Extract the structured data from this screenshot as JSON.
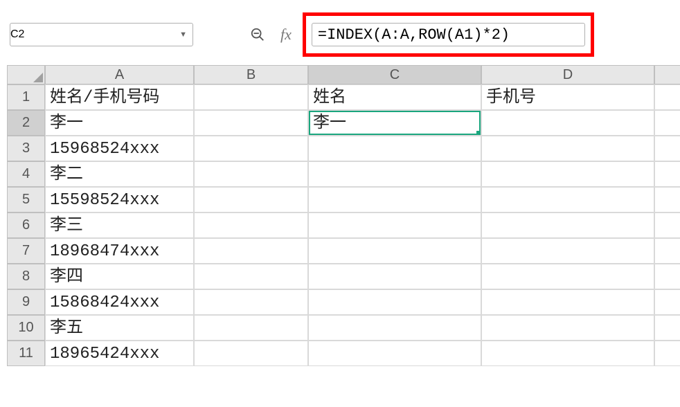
{
  "name_box": {
    "value": "C2"
  },
  "formula_bar": {
    "value": "=INDEX(A:A,ROW(A1)*2)"
  },
  "columns": [
    "A",
    "B",
    "C",
    "D"
  ],
  "row_numbers": [
    1,
    2,
    3,
    4,
    5,
    6,
    7,
    8,
    9,
    10,
    11
  ],
  "active_cell": {
    "col": "C",
    "row": 2
  },
  "cells": {
    "r1": {
      "A": "姓名/手机号码",
      "B": "",
      "C": "姓名",
      "D": "手机号"
    },
    "r2": {
      "A": "李一",
      "B": "",
      "C": "李一",
      "D": ""
    },
    "r3": {
      "A": "15968524xxx",
      "B": "",
      "C": "",
      "D": ""
    },
    "r4": {
      "A": "李二",
      "B": "",
      "C": "",
      "D": ""
    },
    "r5": {
      "A": "15598524xxx",
      "B": "",
      "C": "",
      "D": ""
    },
    "r6": {
      "A": "李三",
      "B": "",
      "C": "",
      "D": ""
    },
    "r7": {
      "A": "18968474xxx",
      "B": "",
      "C": "",
      "D": ""
    },
    "r8": {
      "A": "李四",
      "B": "",
      "C": "",
      "D": ""
    },
    "r9": {
      "A": "15868424xxx",
      "B": "",
      "C": "",
      "D": ""
    },
    "r10": {
      "A": "李五",
      "B": "",
      "C": "",
      "D": ""
    },
    "r11": {
      "A": "18965424xxx",
      "B": "",
      "C": "",
      "D": ""
    }
  }
}
